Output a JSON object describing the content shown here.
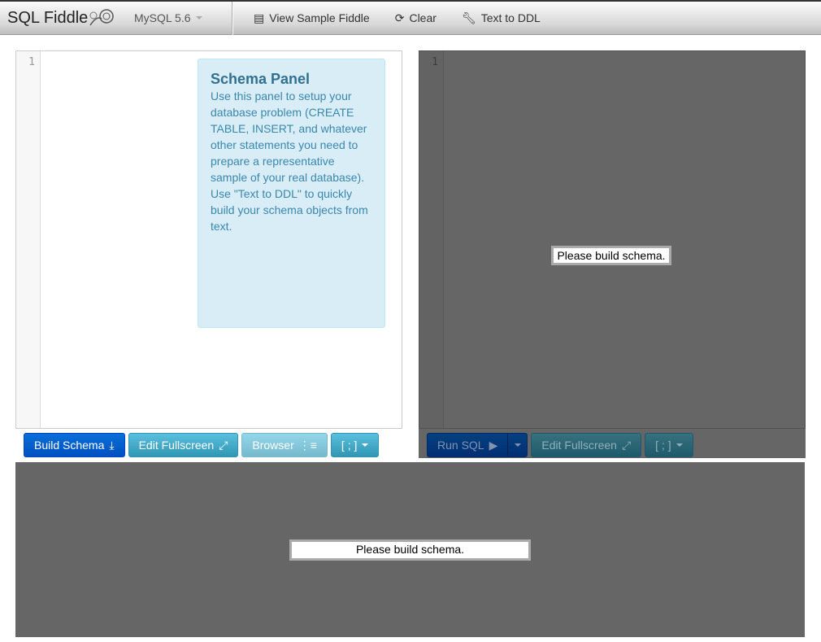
{
  "nav": {
    "brand": "SQL Fiddle",
    "db_select": "MySQL 5.6",
    "view_sample": "View Sample Fiddle",
    "clear": "Clear",
    "text_to_ddl": "Text to DDL"
  },
  "schema": {
    "line": "1",
    "help_title": "Schema Panel",
    "help_text": "Use this panel to setup your database problem (CREATE TABLE, INSERT, and whatever other statements you need to prepare a representative sample of your real database). Use \"Text to DDL\" to quickly build your schema objects from text.",
    "build": "Build Schema",
    "fullscreen": "Edit Fullscreen",
    "browser": "Browser",
    "terminator": "[ ; ]"
  },
  "query": {
    "line": "1",
    "run": "Run SQL",
    "fullscreen": "Edit Fullscreen",
    "terminator": "[ ; ]",
    "message": "Please build schema."
  },
  "results": {
    "message": "Please build schema."
  }
}
